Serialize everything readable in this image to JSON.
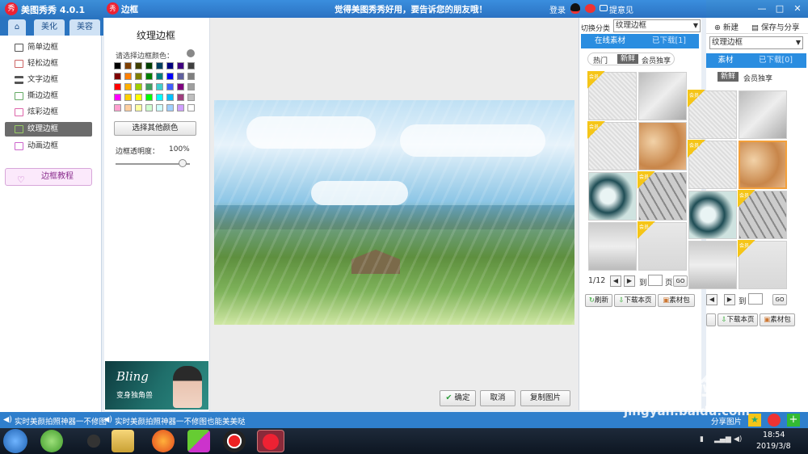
{
  "main_window": {
    "title": "美图秀秀 4.0.1",
    "tabs": [
      "美化",
      "美容"
    ],
    "controls": [
      "—",
      "□",
      "✕"
    ]
  },
  "left_menu": {
    "items": [
      "简单边框",
      "轻松边框",
      "文字边框",
      "撕边边框",
      "炫彩边框",
      "纹理边框",
      "动画边框"
    ],
    "selected": "纹理边框",
    "tutorial": "边框教程"
  },
  "dialog": {
    "title": "边框",
    "slogan": "觉得美图秀秀好用，要告诉您的朋友哦！",
    "login": "登录",
    "feedback": "提意见",
    "panel_title": "纹理边框",
    "color_label": "请选择边框颜色：",
    "other_color_btn": "选择其他颜色",
    "opacity_label": "边框透明度：",
    "opacity_value": "100%",
    "opacity_level": 1.0,
    "banner_text": "Bling",
    "banner_sub": "变身独角兽",
    "confirm_btn": "确定",
    "cancel_btn": "取消",
    "copy_btn": "复制图片"
  },
  "swatches": [
    "#000000",
    "#7f3f00",
    "#3f3f00",
    "#003f00",
    "#003f5f",
    "#00007f",
    "#3f007f",
    "#3f3f3f",
    "#7f0000",
    "#ff7f00",
    "#7f7f00",
    "#007f00",
    "#007f7f",
    "#0000ff",
    "#5f5f9f",
    "#7f7f7f",
    "#ff0000",
    "#ffaf00",
    "#9fcf00",
    "#3f9f5f",
    "#3fcfcf",
    "#3f5fff",
    "#7f007f",
    "#9f9f9f",
    "#ff00ff",
    "#ffcf00",
    "#ffff00",
    "#00ff00",
    "#00ffff",
    "#00bfff",
    "#9f3f7f",
    "#bfbfbf",
    "#ff9fcf",
    "#ffcf9f",
    "#ffff9f",
    "#cfffcf",
    "#cfffff",
    "#9fcfff",
    "#cf9fff",
    "#ffffff"
  ],
  "right_panel": {
    "category_label": "切换分类",
    "category_value": "纹理边框",
    "tabs": [
      "在线素材",
      "已下载[1]"
    ],
    "subtabs": [
      "热门",
      "新鲜",
      "会员独享"
    ],
    "vip_tag": "会员",
    "page_info": "1/12",
    "goto_label": "到",
    "page_label": "页",
    "go_btn": "GO",
    "refresh": "刷新",
    "download_page": "下载本页",
    "pack": "素材包"
  },
  "far_right": {
    "new_btn": "新建",
    "save_btn": "保存与分享",
    "category_value": "纹理边框",
    "tabs": [
      "素材",
      "已下载[0]"
    ],
    "subtabs": [
      "新鲜",
      "会员独享"
    ],
    "goto_label": "到",
    "go_btn": "GO",
    "download_page": "下载本页",
    "pack": "素材包",
    "share": "分享图片"
  },
  "status_bar": {
    "left": "实时美颜拍照神器一不修图",
    "right": "实时美颜拍照神器一不修图也能美美哒"
  },
  "taskbar": {
    "time": "18:54",
    "date": "2019/3/8"
  },
  "watermark": {
    "main": "Bai 经验",
    "sub": "jingyan.baidu.com"
  }
}
